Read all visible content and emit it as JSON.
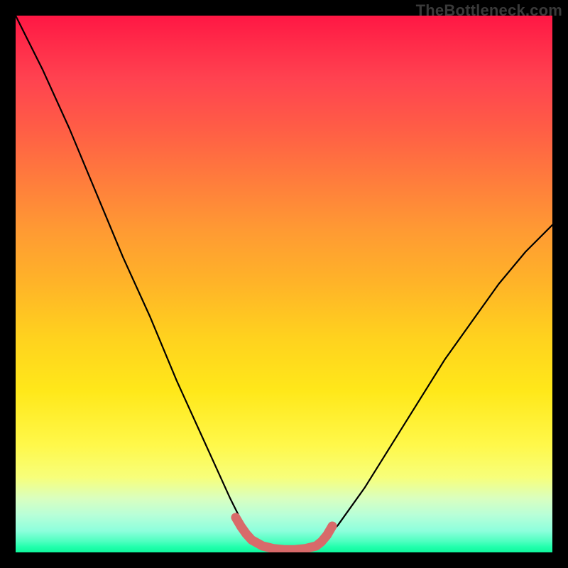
{
  "watermark": "TheBottleneck.com",
  "chart_data": {
    "type": "line",
    "title": "",
    "xlabel": "",
    "ylabel": "",
    "xlim": [
      0,
      100
    ],
    "ylim": [
      0,
      100
    ],
    "grid": false,
    "background_gradient": {
      "orientation": "vertical",
      "stops": [
        {
          "pos": 0.0,
          "color": "#ff1744"
        },
        {
          "pos": 0.5,
          "color": "#ffd21e"
        },
        {
          "pos": 0.9,
          "color": "#d9ffc0"
        },
        {
          "pos": 1.0,
          "color": "#10f79d"
        }
      ]
    },
    "series": [
      {
        "name": "bottleneck-curve",
        "stroke": "#000000",
        "x": [
          0,
          5,
          10,
          15,
          20,
          25,
          30,
          35,
          40,
          42,
          44,
          46,
          48,
          50,
          52,
          54,
          56,
          60,
          65,
          70,
          75,
          80,
          85,
          90,
          95,
          100
        ],
        "y": [
          100,
          90,
          79,
          67,
          55,
          44,
          32,
          21,
          10,
          6,
          3,
          1.2,
          0.6,
          0.5,
          0.5,
          0.6,
          1.2,
          5,
          12,
          20,
          28,
          36,
          43,
          50,
          56,
          61
        ]
      },
      {
        "name": "valley-band",
        "stroke": "#d86a6a",
        "stroke_width": 10,
        "x": [
          41,
          42,
          43,
          44,
          46,
          48,
          50,
          52,
          54,
          56,
          57,
          58,
          59
        ],
        "y": [
          6.5,
          4.8,
          3.4,
          2.3,
          1.2,
          0.7,
          0.5,
          0.5,
          0.7,
          1.2,
          2.0,
          3.2,
          4.9
        ]
      }
    ]
  }
}
